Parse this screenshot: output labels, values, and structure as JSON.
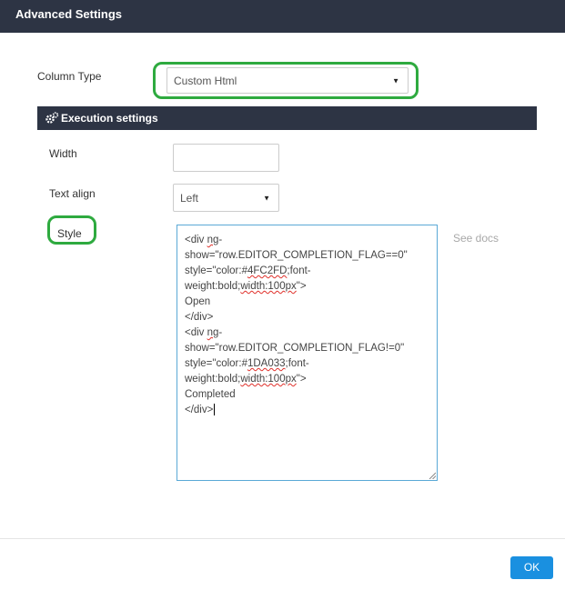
{
  "dialog": {
    "title": "Advanced Settings"
  },
  "column_type": {
    "label": "Column Type",
    "value": "Custom Html"
  },
  "execution": {
    "title": "Execution settings",
    "width_label": "Width",
    "width_value": "",
    "text_align_label": "Text align",
    "text_align_value": "Left",
    "style_label": "Style",
    "style_lines": [
      "<div ng-",
      "show=\"row.EDITOR_COMPLETION_FLAG==0\"",
      "style=\"color:#4FC2FD;font-",
      "weight:bold;width:100px\">",
      "Open",
      "</div>",
      "<div ng-",
      "show=\"row.EDITOR_COMPLETION_FLAG!=0\"",
      "style=\"color:#1DA033;font-",
      "weight:bold;width:100px\">",
      "Completed",
      "</div>"
    ],
    "see_docs": "See docs"
  },
  "footer": {
    "ok_label": "OK"
  },
  "colors": {
    "header_bg": "#2d3444",
    "highlight": "#2eaa3f",
    "primary": "#1a90e0"
  }
}
